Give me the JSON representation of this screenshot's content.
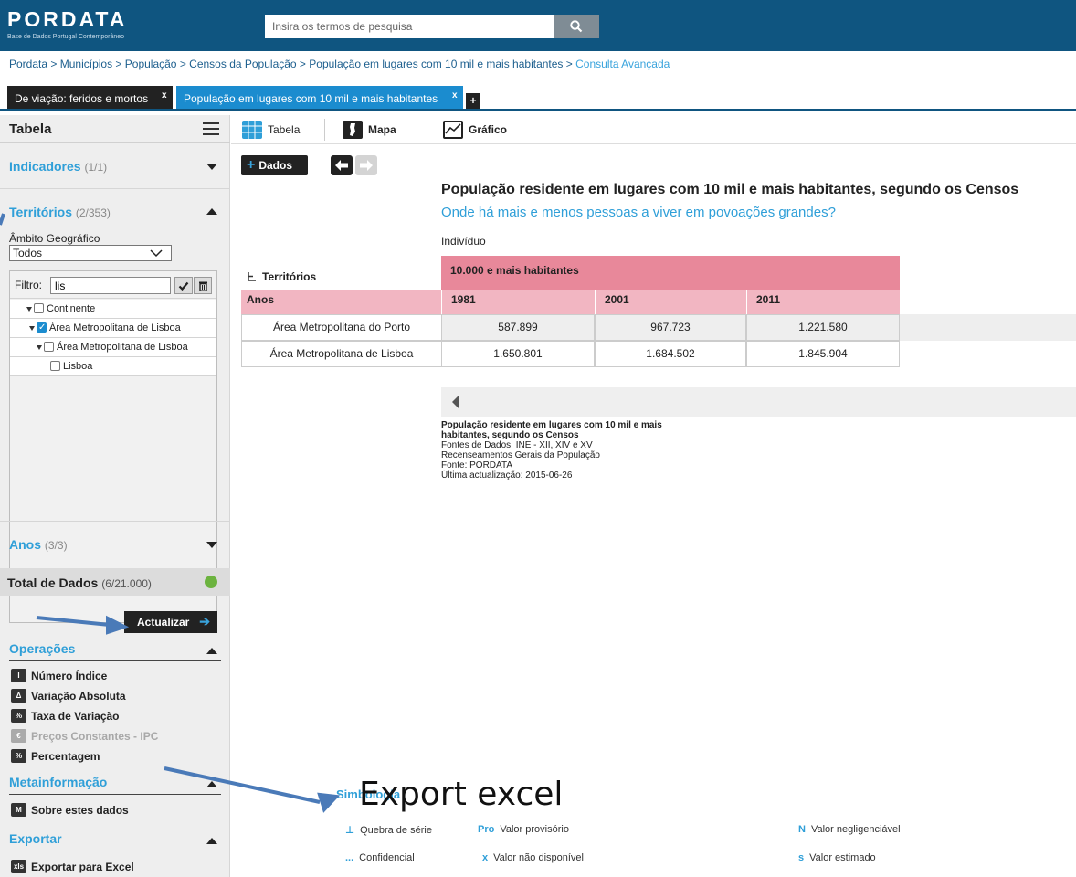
{
  "header": {
    "logo_text": "PORDATA",
    "logo_tagline": "Base de Dados Portugal Contemporâneo",
    "search_placeholder": "Insira os termos de pesquisa"
  },
  "breadcrumb": [
    "Pordata",
    "Municípios",
    "População",
    "Censos da População",
    "População em lugares com 10 mil e mais habitantes",
    "Consulta Avançada"
  ],
  "tabs": [
    {
      "label": "De viação: feridos e mortos",
      "close": "x"
    },
    {
      "label": "População em lugares com 10 mil e mais habitantes",
      "close": "x"
    }
  ],
  "tab_add": "+",
  "sidebar": {
    "title": "Tabela",
    "indicadores": {
      "label": "Indicadores",
      "count": "(1/1)"
    },
    "territorios": {
      "label": "Territórios",
      "count": "(2/353)"
    },
    "ambito_label": "Âmbito Geográfico",
    "ambito_value": "Todos",
    "filter_label": "Filtro:",
    "filter_value": "lis",
    "tree": [
      {
        "label": "Continente",
        "checked": false
      },
      {
        "label": "Área Metropolitana de Lisboa",
        "checked": true
      },
      {
        "label": "Área Metropolitana de Lisboa",
        "checked": false
      },
      {
        "label": "Lisboa",
        "checked": false
      }
    ],
    "anos": {
      "label": "Anos",
      "count": "(3/3)"
    },
    "total": {
      "label": "Total de Dados",
      "count": "(6/21.000)"
    },
    "update_button": "Actualizar",
    "operacoes": {
      "title": "Operações",
      "items": [
        {
          "label": "Número Índice",
          "icon": "indice-icon",
          "enabled": true
        },
        {
          "label": "Variação Absoluta",
          "icon": "variacao-icon",
          "enabled": true
        },
        {
          "label": "Taxa de Variação",
          "icon": "taxa-icon",
          "enabled": true
        },
        {
          "label": "Preços Constantes - IPC",
          "icon": "ipc-icon",
          "enabled": false
        },
        {
          "label": "Percentagem",
          "icon": "percent-icon",
          "enabled": true
        }
      ]
    },
    "metainformacao": {
      "title": "Metainformação",
      "item": "Sobre estes dados"
    },
    "exportar": {
      "title": "Exportar",
      "item": "Exportar para Excel"
    }
  },
  "views": {
    "tabela": "Tabela",
    "mapa": "Mapa",
    "grafico": "Gráfico"
  },
  "dados_button": "Dados",
  "table": {
    "title": "População residente em lugares com 10 mil e mais habitantes, segundo os Censos",
    "subtitle": "Onde há mais e menos pessoas a viver em povoações grandes?",
    "unit": "Indivíduo",
    "group_header": "10.000 e mais habitantes",
    "dimension_header": "Territórios",
    "row_header": "Anos",
    "years": [
      "1981",
      "2001",
      "2011"
    ],
    "rows": [
      {
        "label": "Área Metropolitana do Porto",
        "values": [
          "587.899",
          "967.723",
          "1.221.580"
        ]
      },
      {
        "label": "Área Metropolitana de Lisboa",
        "values": [
          "1.650.801",
          "1.684.502",
          "1.845.904"
        ]
      }
    ]
  },
  "source_note": {
    "title": "População residente em lugares com 10 mil e mais habitantes, segundo os Censos",
    "line1": "Fontes de Dados: INE - XII, XIV e XV",
    "line2": "Recenseamentos Gerais da População",
    "line3": "Fonte: PORDATA",
    "line4": "Última actualização: 2015-06-26"
  },
  "legend": {
    "title": "Simbologia",
    "items": [
      {
        "symbol": "⊥",
        "label": "Quebra de série"
      },
      {
        "symbol": "Pro",
        "label": "Valor provisório"
      },
      {
        "symbol": "N",
        "label": "Valor negligenciável"
      },
      {
        "symbol": "...",
        "label": "Confidencial"
      },
      {
        "symbol": "x",
        "label": "Valor não disponível"
      },
      {
        "symbol": "s",
        "label": "Valor estimado"
      }
    ]
  },
  "annotation": "Export excel",
  "colors": {
    "header_bg": "#0f5580",
    "accent": "#2f9fd8",
    "tab_active": "#1b8ccf",
    "group_header": "#e8889a",
    "sub_header": "#f2b6c2"
  }
}
